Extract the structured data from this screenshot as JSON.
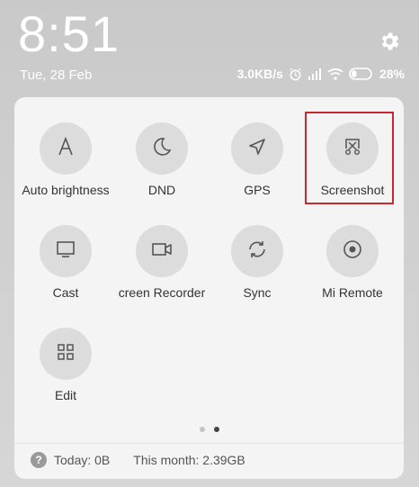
{
  "status": {
    "time": "8:51",
    "date": "Tue, 28 Feb",
    "network_speed": "3.0KB/s",
    "battery_percent": "28%",
    "battery_level": 0.28,
    "icons": [
      "alarm-icon",
      "signal-icon",
      "wifi-icon",
      "battery-icon",
      "settings-gear-icon"
    ]
  },
  "tiles": [
    {
      "label": "Auto brightness",
      "icon": "font-a-icon"
    },
    {
      "label": "DND",
      "icon": "moon-icon"
    },
    {
      "label": "GPS",
      "icon": "location-arrow-icon"
    },
    {
      "label": "Screenshot",
      "icon": "screenshot-scissors-icon"
    },
    {
      "label": "Cast",
      "icon": "monitor-icon"
    },
    {
      "label": "creen Recorder",
      "icon": "video-camera-icon"
    },
    {
      "label": "Sync",
      "icon": "sync-icon"
    },
    {
      "label": "Mi Remote",
      "icon": "remote-target-icon"
    },
    {
      "label": "Edit",
      "icon": "grid-icon"
    }
  ],
  "pager": {
    "pages": 2,
    "current": 2
  },
  "footer": {
    "help_glyph": "?",
    "today": "Today: 0B",
    "this_month": "This month: 2.39GB"
  },
  "highlight": {
    "target": "Screenshot",
    "color": "#c8282e"
  }
}
